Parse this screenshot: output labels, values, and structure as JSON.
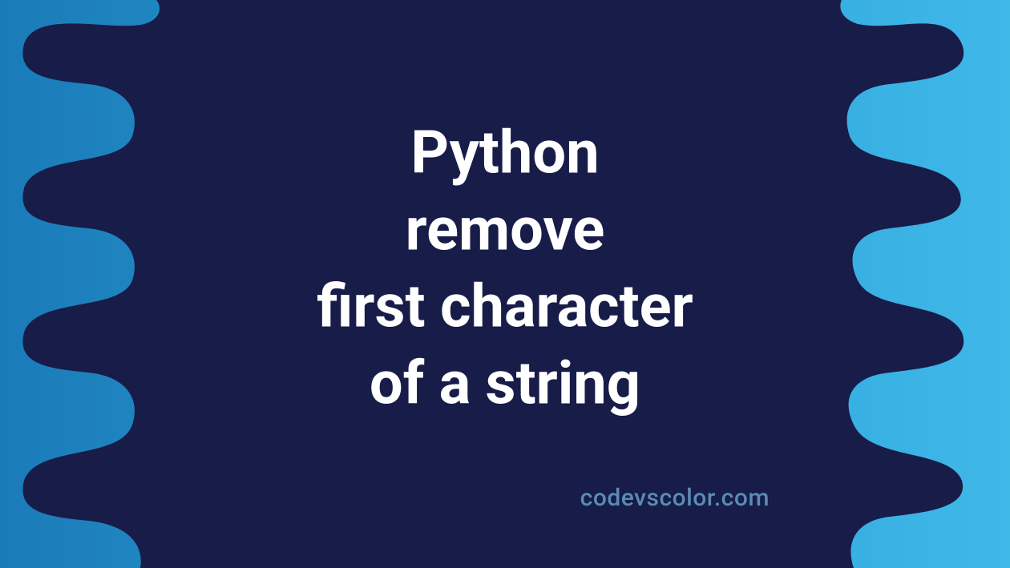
{
  "title_lines": {
    "line1": "Python",
    "line2": "remove",
    "line3": "first character",
    "line4": "of a string"
  },
  "credit": "codevscolor.com",
  "colors": {
    "gradient_start": "#1a7bb8",
    "gradient_end": "#3fb8e8",
    "blob_fill": "#171c48",
    "title_color": "#ffffff",
    "credit_color": "#5b8bb5"
  }
}
